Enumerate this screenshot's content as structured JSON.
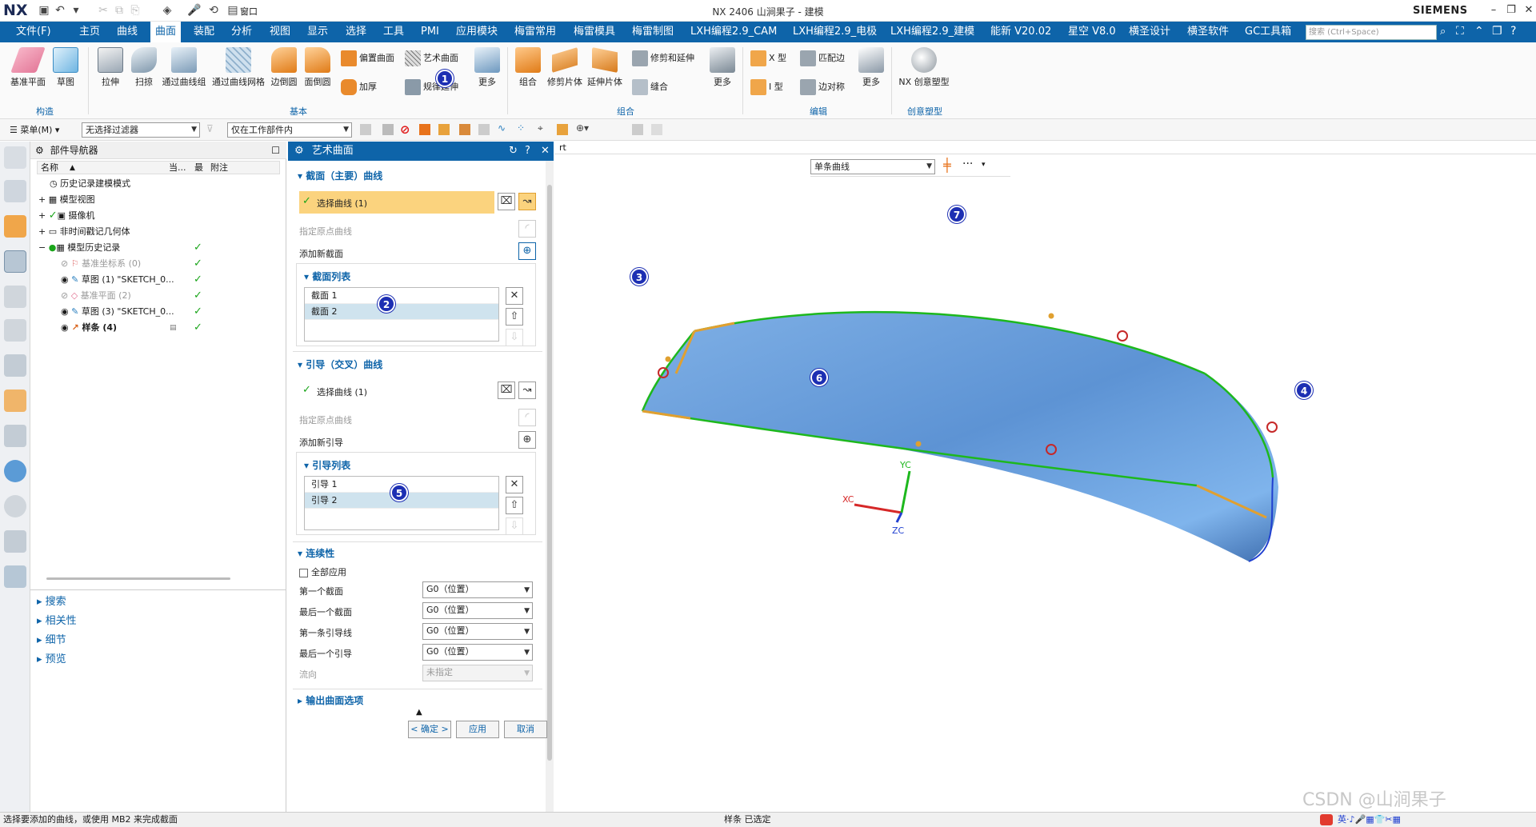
{
  "app": {
    "logo": "NX",
    "title": "NX 2406 山涧果子 - 建模",
    "brand": "SIEMENS",
    "window_menu": "窗口"
  },
  "menu": {
    "items": [
      "文件(F)",
      "主页",
      "曲线",
      "曲面",
      "装配",
      "分析",
      "视图",
      "显示",
      "选择",
      "工具",
      "PMI",
      "应用模块",
      "梅雷常用",
      "梅雷模具",
      "梅雷制图",
      "LXH编程2.9_CAM",
      "LXH编程2.9_电极",
      "LXH编程2.9_建模",
      "能新 V20.02",
      "星空 V8.0",
      "横圣设计",
      "横圣软件",
      "GC工具箱"
    ],
    "active": "曲面",
    "search_placeholder": "搜索 (Ctrl+Space)"
  },
  "ribbon": {
    "groups": {
      "construct": "构造",
      "basic": "基本",
      "combine": "组合",
      "edit": "编辑",
      "creative": "创意塑型"
    },
    "buttons": {
      "datum_plane": "基准平面",
      "sketch": "草图",
      "extrude": "拉伸",
      "sweep": "扫掠",
      "through_curves": "通过曲线组",
      "through_mesh": "通过曲线网格",
      "edge_blend": "边倒圆",
      "face_blend": "面倒圆",
      "offset_surface": "偏置曲面",
      "studio_surface": "艺术曲面",
      "thicken": "加厚",
      "law_extension": "规律延伸",
      "more1": "更多",
      "unite": "组合",
      "trim_sheet": "修剪片体",
      "extend_sheet": "延伸片体",
      "trim_extend": "修剪和延伸",
      "sew": "缝合",
      "more2": "更多",
      "x_form": "X 型",
      "match_edge": "匹配边",
      "i_form": "I 型",
      "edge_symmetry": "边对称",
      "more3": "更多",
      "nx_creative": "NX 创意塑型"
    }
  },
  "toolbar2": {
    "menu": "菜单(M)",
    "filter": "无选择过滤器",
    "scope": "仅在工作部件内"
  },
  "navigator": {
    "title": "部件导航器",
    "columns": [
      "名称",
      "当...",
      "最",
      "附注"
    ],
    "items": [
      {
        "label": "历史记录建模模式",
        "state": ""
      },
      {
        "label": "模型视图",
        "state": ""
      },
      {
        "label": "摄像机",
        "state": ""
      },
      {
        "label": "非时间戳记几何体",
        "state": ""
      },
      {
        "label": "模型历史记录",
        "state": "✓"
      },
      {
        "label": "基准坐标系 (0)",
        "state": "✓"
      },
      {
        "label": "草图 (1) \"SKETCH_0...",
        "state": "✓"
      },
      {
        "label": "基准平面 (2)",
        "state": "✓"
      },
      {
        "label": "草图 (3) \"SKETCH_0...",
        "state": "✓"
      },
      {
        "label": "样条 (4)",
        "state": "✓"
      }
    ],
    "panels": [
      "搜索",
      "相关性",
      "细节",
      "预览"
    ]
  },
  "dialog": {
    "title": "艺术曲面",
    "section1": "截面（主要）曲线",
    "select_curve1": "选择曲线 (1)",
    "origin_curve1": "指定原点曲线",
    "add_section": "添加新截面",
    "section_list_title": "截面列表",
    "section_list": [
      "截面 1",
      "截面 2"
    ],
    "section2": "引导（交叉）曲线",
    "select_curve2": "选择曲线 (1)",
    "origin_curve2": "指定原点曲线",
    "add_guide": "添加新引导",
    "guide_list_title": "引导列表",
    "guide_list": [
      "引导 1",
      "引导 2"
    ],
    "continuity": "连续性",
    "apply_all": "全部应用",
    "first_section": "第一个截面",
    "last_section": "最后一个截面",
    "first_guide": "第一条引导线",
    "last_guide": "最后一个引导",
    "flow_direction": "流向",
    "g0": "G0（位置）",
    "unspecified": "未指定",
    "output_options": "输出曲面选项",
    "ok": "< 确定 >",
    "apply": "应用",
    "cancel": "取消"
  },
  "viewport": {
    "curve_rule": "单条曲线",
    "axes": {
      "xc": "XC",
      "yc": "YC",
      "zc": "ZC"
    },
    "tab_fragment": "rt"
  },
  "badges": [
    "1",
    "2",
    "3",
    "4",
    "5",
    "6",
    "7"
  ],
  "status": {
    "left": "选择要添加的曲线，或使用 MB2 来完成截面",
    "center": "样条 已选定"
  },
  "watermark": "CSDN @山涧果子",
  "colors": {
    "accent": "#0e64a9",
    "surface": "#6ea3e0",
    "edge": "#1db81d",
    "badge": "#1d2fb3"
  }
}
